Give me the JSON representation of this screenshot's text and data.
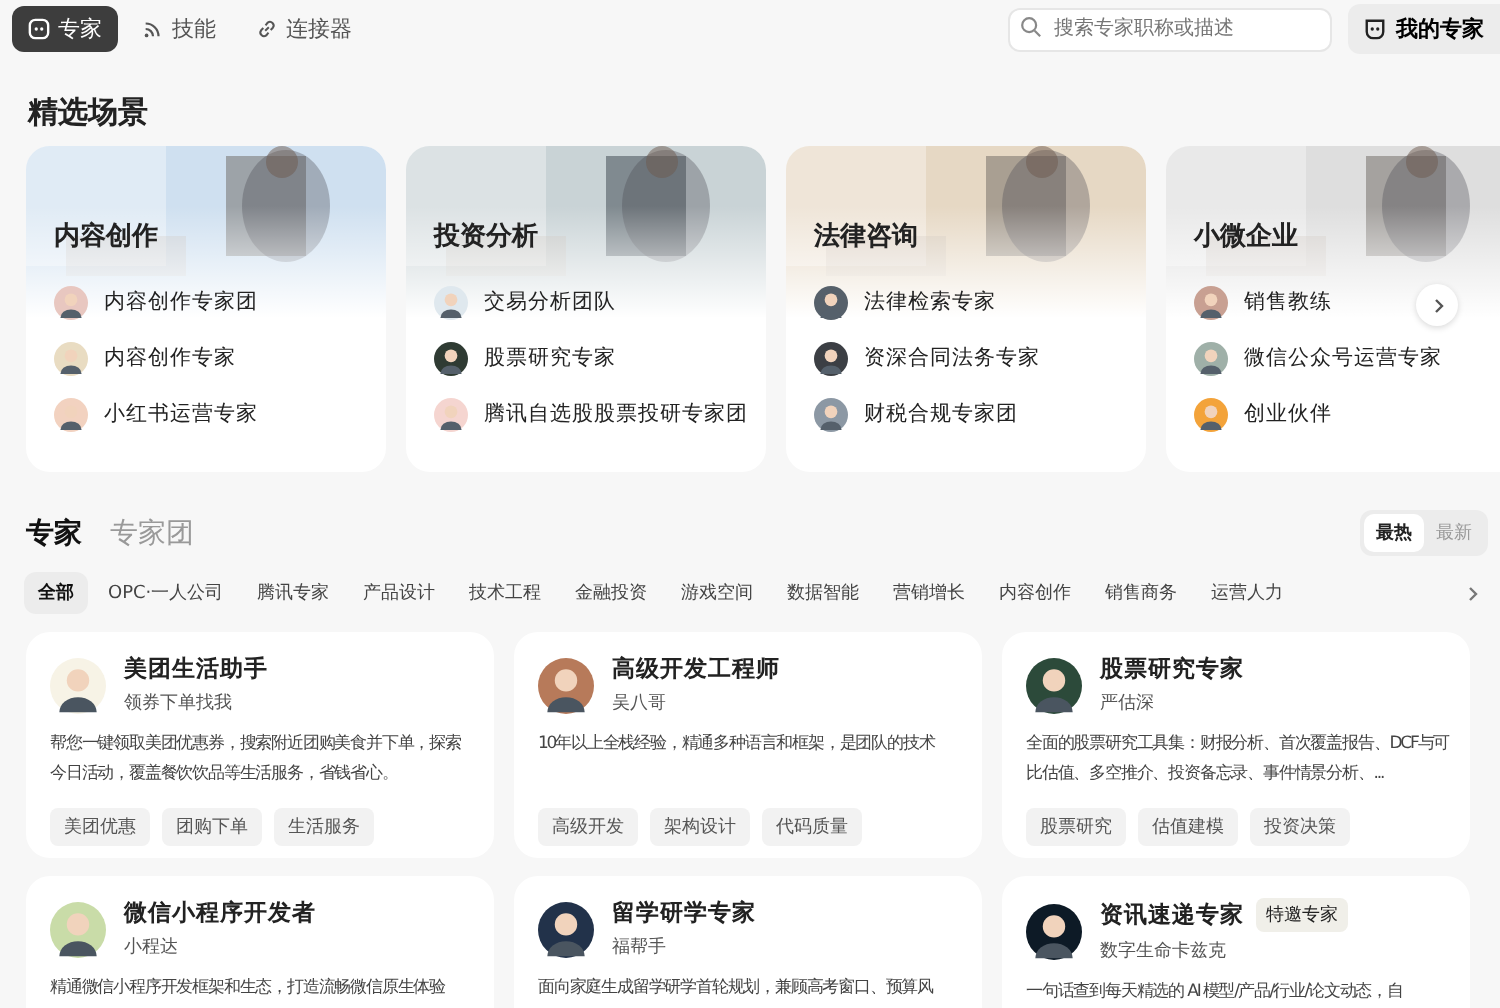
{
  "top_nav": {
    "tabs": [
      {
        "label": "专家",
        "selected": true
      },
      {
        "label": "技能",
        "selected": false
      },
      {
        "label": "连接器",
        "selected": false
      }
    ],
    "search": {
      "placeholder": "搜索专家职称或描述"
    },
    "my_button": "我的专家"
  },
  "scenes": {
    "title": "精选场景",
    "cards": [
      {
        "title": "内容创作",
        "experts": [
          "内容创作专家团",
          "内容创作专家",
          "小红书运营专家"
        ]
      },
      {
        "title": "投资分析",
        "experts": [
          "交易分析团队",
          "股票研究专家",
          "腾讯自选股股票投研专家团"
        ]
      },
      {
        "title": "法律咨询",
        "experts": [
          "法律检索专家",
          "资深合同法务专家",
          "财税合规专家团"
        ]
      },
      {
        "title": "小微企业",
        "experts": [
          "销售教练",
          "微信公众号运营专家",
          "创业伙伴"
        ]
      }
    ]
  },
  "experts": {
    "tabs": [
      {
        "label": "专家",
        "selected": true
      },
      {
        "label": "专家团",
        "selected": false
      }
    ],
    "sort": [
      {
        "label": "最热",
        "selected": true
      },
      {
        "label": "最新",
        "selected": false
      }
    ],
    "categories": [
      {
        "label": "全部",
        "selected": true
      },
      {
        "label": "OPC·一人公司",
        "selected": false
      },
      {
        "label": "腾讯专家",
        "selected": false
      },
      {
        "label": "产品设计",
        "selected": false
      },
      {
        "label": "技术工程",
        "selected": false
      },
      {
        "label": "金融投资",
        "selected": false
      },
      {
        "label": "游戏空间",
        "selected": false
      },
      {
        "label": "数据智能",
        "selected": false
      },
      {
        "label": "营销增长",
        "selected": false
      },
      {
        "label": "内容创作",
        "selected": false
      },
      {
        "label": "销售商务",
        "selected": false
      },
      {
        "label": "运营人力",
        "selected": false
      }
    ],
    "cards": [
      {
        "name": "美团生活助手",
        "subtitle": "领券下单找我",
        "description": "帮您一键领取美团优惠券，搜索附近团购美食并下单，探索今日活动，覆盖餐饮饮品等生活服务，省钱省心。",
        "tags": [
          "美团优惠",
          "团购下单",
          "生活服务"
        ]
      },
      {
        "name": "高级开发工程师",
        "subtitle": "吴八哥",
        "description": "10年以上全栈经验，精通多种语言和框架，是团队的技术",
        "tags": [
          "高级开发",
          "架构设计",
          "代码质量"
        ]
      },
      {
        "name": "股票研究专家",
        "subtitle": "严估深",
        "description": "全面的股票研究工具集：财报分析、首次覆盖报告、DCF与可比估值、多空推介、投资备忘录、事件情景分析、...",
        "tags": [
          "股票研究",
          "估值建模",
          "投资决策"
        ]
      },
      {
        "name": "微信小程序开发者",
        "subtitle": "小程达",
        "description": "精通微信小程序开发框架和生态，打造流畅微信原生体验"
      },
      {
        "name": "留学研学专家",
        "subtitle": "福帮手",
        "description": "面向家庭生成留学研学首轮规划，兼顾高考窗口、预算风"
      },
      {
        "name": "资讯速递专家",
        "badge": "特邀专家",
        "subtitle": "数字生命卡兹克",
        "description": "一句话查到每天精选的 AI 模型/产品/行业/论文动态，自"
      }
    ]
  }
}
